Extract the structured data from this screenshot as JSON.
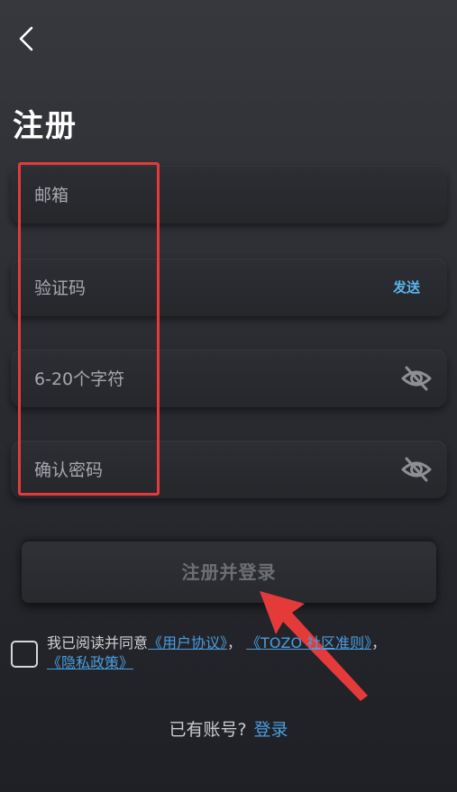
{
  "page": {
    "title": "注册"
  },
  "form": {
    "email_placeholder": "邮箱",
    "code_placeholder": "验证码",
    "send_label": "发送",
    "password_placeholder": "6-20个字符",
    "confirm_placeholder": "确认密码",
    "submit_label": "注册并登录"
  },
  "agreement": {
    "prefix": "我已阅读并同意",
    "user_agreement": "《用户协议》",
    "sep1": "，",
    "community": "《TOZO 社区准则》",
    "sep2": "，",
    "privacy": "《隐私政策》"
  },
  "footer": {
    "question": "已有账号?",
    "login_label": "登录"
  },
  "colors": {
    "accent": "#4a9ee0",
    "send": "#58b4ef",
    "annotation": "#e53a3a"
  }
}
